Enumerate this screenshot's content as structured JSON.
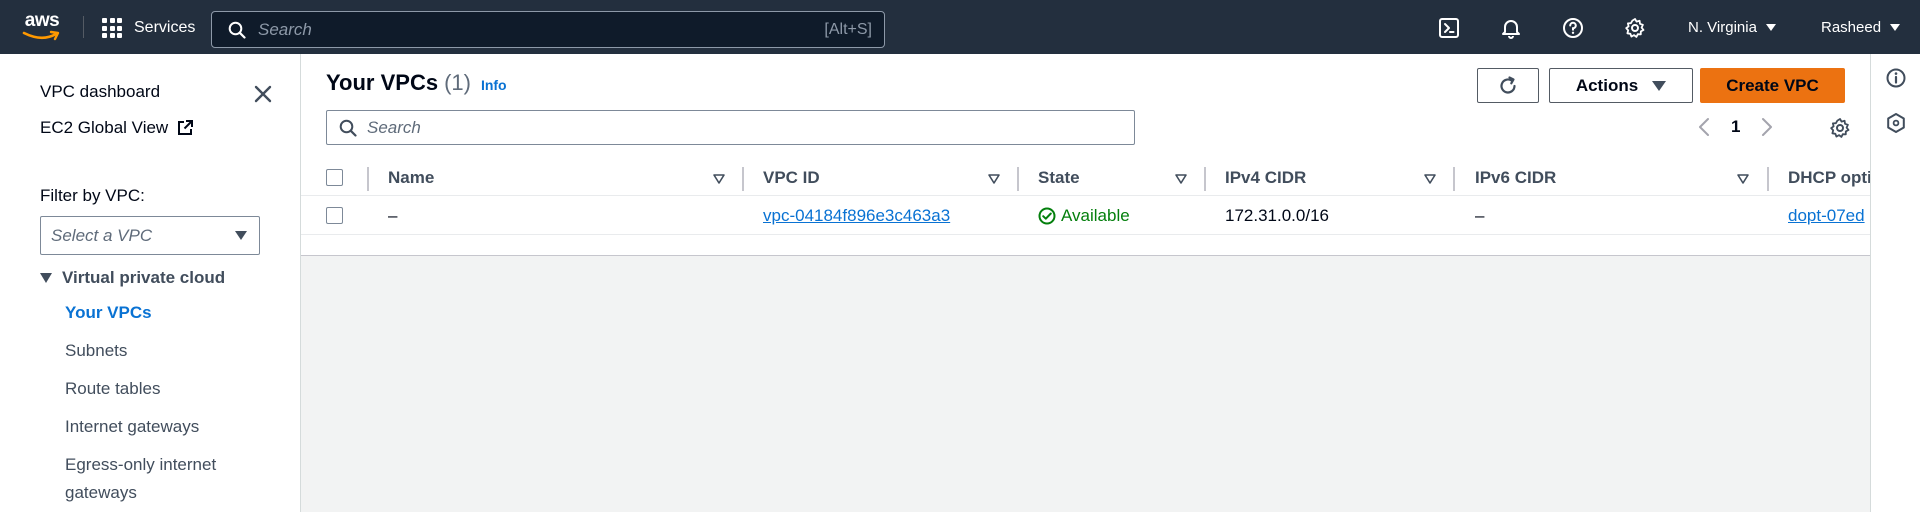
{
  "topnav": {
    "logo_text": "aws",
    "services_label": "Services",
    "search_placeholder": "Search",
    "search_shortcut": "[Alt+S]",
    "region_label": "N. Virginia",
    "user_label": "Rasheed",
    "icons": [
      "cloudshell-icon",
      "bell-icon",
      "help-icon",
      "settings-icon"
    ]
  },
  "sidebar": {
    "dashboard_label": "VPC dashboard",
    "ec2_global_label": "EC2 Global View",
    "filter_label": "Filter by VPC:",
    "filter_placeholder": "Select a VPC",
    "section_label": "Virtual private cloud",
    "items": [
      {
        "label": "Your VPCs",
        "active": true
      },
      {
        "label": "Subnets"
      },
      {
        "label": "Route tables"
      },
      {
        "label": "Internet gateways"
      },
      {
        "label": "Egress-only internet"
      },
      {
        "label": "gateways"
      }
    ]
  },
  "main": {
    "title": "Your VPCs",
    "count": "(1)",
    "info_label": "Info",
    "actions_label": "Actions",
    "create_label": "Create VPC",
    "search_placeholder": "Search",
    "page_number": "1",
    "columns": [
      "Name",
      "VPC ID",
      "State",
      "IPv4 CIDR",
      "IPv6 CIDR",
      "DHCP opti"
    ],
    "rows": [
      {
        "name": "–",
        "vpc_id": "vpc-04184f896e3c463a3",
        "state": "Available",
        "ipv4_cidr": "172.31.0.0/16",
        "ipv6_cidr": "–",
        "dhcp_options": "dopt-07ed"
      }
    ]
  },
  "colors": {
    "nav_bg": "#232f3e",
    "link": "#0972d3",
    "primary_button": "#ec7211",
    "status_success": "#037f0c",
    "canvas_bg": "#f2f3f3"
  }
}
